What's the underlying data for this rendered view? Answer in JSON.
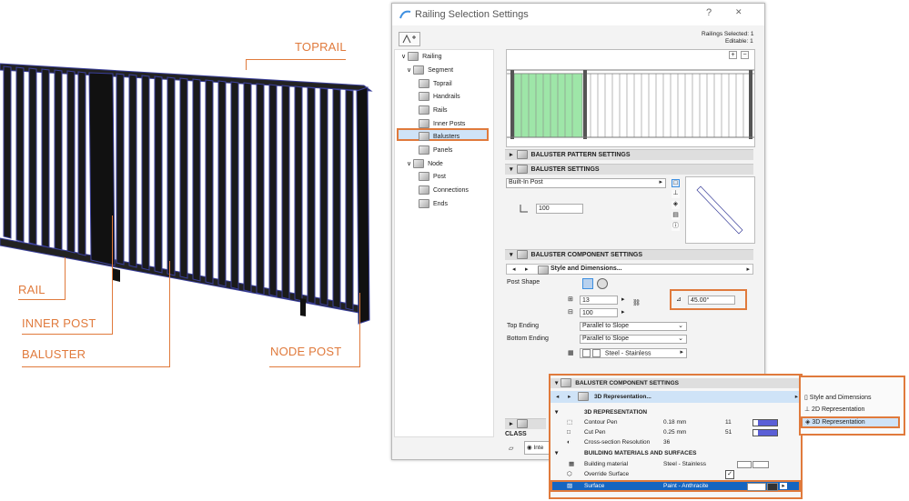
{
  "callouts": {
    "toprail": "TOPRAIL",
    "rail": "RAIL",
    "inner_post": "INNER POST",
    "baluster": "BALUSTER",
    "node_post": "NODE POST"
  },
  "dialog": {
    "title": "Railing Selection Settings",
    "help": "?",
    "minimize": "—",
    "close": "✕",
    "railings_selected": "Railings Selected: 1",
    "editable": "Editable: 1"
  },
  "tree": {
    "railing": "Railing",
    "segment": "Segment",
    "toprail": "Toprail",
    "handrails": "Handrails",
    "rails": "Rails",
    "inner_posts": "Inner Posts",
    "balusters": "Balusters",
    "panels": "Panels",
    "node": "Node",
    "post": "Post",
    "connections": "Connections",
    "ends": "Ends"
  },
  "preview": {
    "plus": "+",
    "minus": "−"
  },
  "panels": {
    "pattern": "BALUSTER PATTERN SETTINGS",
    "settings": "BALUSTER SETTINGS",
    "component": "BALUSTER COMPONENT SETTINGS",
    "classification": "CLASS"
  },
  "baluster_settings": {
    "builtin": "Built-In Post",
    "height_value": "100"
  },
  "component": {
    "page": "Style and Dimensions...",
    "post_shape": "Post Shape",
    "width": "13",
    "depth": "100",
    "angle": "45.00°",
    "top_ending_label": "Top Ending",
    "top_ending_value": "Parallel to Slope",
    "bottom_ending_label": "Bottom Ending",
    "bottom_ending_value": "Parallel to Slope",
    "material": "Steel - Stainless"
  },
  "overlay": {
    "title": "BALUSTER COMPONENT SETTINGS",
    "page": "3D Representation...",
    "section_3d": "3D REPRESENTATION",
    "contour_pen": "Contour Pen",
    "contour_pen_value": "0.18 mm",
    "contour_pen_num": "11",
    "cut_pen": "Cut Pen",
    "cut_pen_value": "0.25 mm",
    "cut_pen_num": "51",
    "cross_section": "Cross-section Resolution",
    "cross_section_value": "36",
    "section_materials": "BUILDING MATERIALS AND SURFACES",
    "building_material": "Building material",
    "building_material_value": "Steel - Stainless",
    "override_surface": "Override Surface",
    "override_check": "✓",
    "surface": "Surface",
    "surface_value": "Paint - Anthracite"
  },
  "submenu": {
    "style": "Style and Dimensions",
    "rep2d": "2D Representation",
    "rep3d": "3D Representation"
  },
  "bottom": {
    "interior": "Inte"
  },
  "colors": {
    "accent": "#e07a3c",
    "selection": "#3d8fe0",
    "baluster_fill": "#9ee6a8"
  }
}
